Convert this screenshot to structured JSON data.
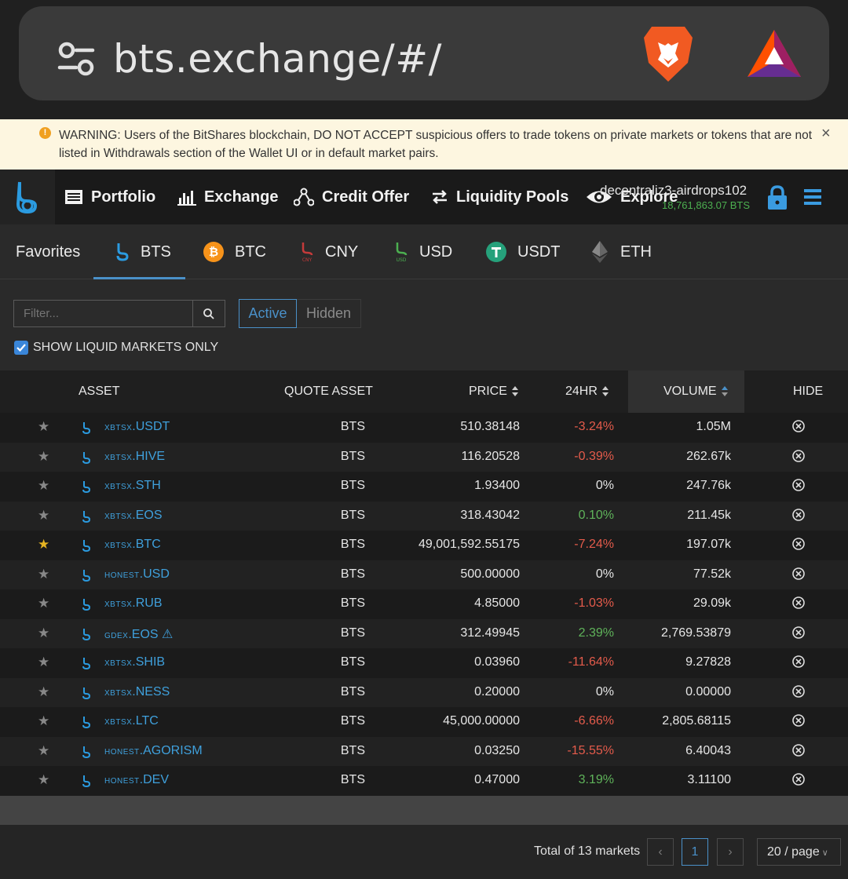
{
  "browser": {
    "url": "bts.exchange/#/",
    "icons": [
      "tune-icon",
      "brave-lion-icon",
      "bat-triangle-icon"
    ]
  },
  "warning": {
    "text": "WARNING: Users of the BitShares blockchain, DO NOT ACCEPT suspicious offers to trade tokens on private markets or tokens that are not listed in Withdrawals section of the Wallet UI or in default market pairs.",
    "close": "×"
  },
  "nav": {
    "items": [
      "Portfolio",
      "Exchange",
      "Credit Offer",
      "Liquidity Pools",
      "Explore"
    ],
    "account_name": "decentraliz3-airdrops102",
    "account_balance": "18,761,863.07 BTS"
  },
  "tabs": {
    "favorites": "Favorites",
    "items": [
      "BTS",
      "BTC",
      "CNY",
      "USD",
      "USDT",
      "ETH"
    ],
    "active": "BTS"
  },
  "filter": {
    "placeholder": "Filter...",
    "active_label": "Active",
    "hidden_label": "Hidden",
    "liquid_only_label": "SHOW LIQUID MARKETS ONLY",
    "liquid_only_checked": true
  },
  "table": {
    "headers": {
      "asset": "ASSET",
      "quote": "QUOTE ASSET",
      "price": "PRICE",
      "change": "24HR",
      "volume": "VOLUME",
      "hide": "HIDE"
    },
    "rows": [
      {
        "prefix": "XBTSX",
        "symbol": ".USDT",
        "warn": "",
        "quote": "BTS",
        "price": "510.38148",
        "change": "-3.24%",
        "dir": "neg",
        "volume": "1.05M",
        "starred": false
      },
      {
        "prefix": "XBTSX",
        "symbol": ".HIVE",
        "warn": "",
        "quote": "BTS",
        "price": "116.20528",
        "change": "-0.39%",
        "dir": "neg",
        "volume": "262.67k",
        "starred": false
      },
      {
        "prefix": "XBTSX",
        "symbol": ".STH",
        "warn": "",
        "quote": "BTS",
        "price": "1.93400",
        "change": "0%",
        "dir": "zero",
        "volume": "247.76k",
        "starred": false
      },
      {
        "prefix": "XBTSX",
        "symbol": ".EOS",
        "warn": "",
        "quote": "BTS",
        "price": "318.43042",
        "change": "0.10%",
        "dir": "pos",
        "volume": "211.45k",
        "starred": false
      },
      {
        "prefix": "XBTSX",
        "symbol": ".BTC",
        "warn": "",
        "quote": "BTS",
        "price": "49,001,592.55175",
        "change": "-7.24%",
        "dir": "neg",
        "volume": "197.07k",
        "starred": true
      },
      {
        "prefix": "HONEST",
        "symbol": ".USD",
        "warn": "",
        "quote": "BTS",
        "price": "500.00000",
        "change": "0%",
        "dir": "zero",
        "volume": "77.52k",
        "starred": false
      },
      {
        "prefix": "XBTSX",
        "symbol": ".RUB",
        "warn": "",
        "quote": "BTS",
        "price": "4.85000",
        "change": "-1.03%",
        "dir": "neg",
        "volume": "29.09k",
        "starred": false
      },
      {
        "prefix": "GDEX",
        "symbol": ".EOS",
        "warn": "⚠",
        "quote": "BTS",
        "price": "312.49945",
        "change": "2.39%",
        "dir": "pos",
        "volume": "2,769.53879",
        "starred": false
      },
      {
        "prefix": "XBTSX",
        "symbol": ".SHIB",
        "warn": "",
        "quote": "BTS",
        "price": "0.03960",
        "change": "-11.64%",
        "dir": "neg",
        "volume": "9.27828",
        "starred": false
      },
      {
        "prefix": "XBTSX",
        "symbol": ".NESS",
        "warn": "",
        "quote": "BTS",
        "price": "0.20000",
        "change": "0%",
        "dir": "zero",
        "volume": "0.00000",
        "starred": false
      },
      {
        "prefix": "XBTSX",
        "symbol": ".LTC",
        "warn": "",
        "quote": "BTS",
        "price": "45,000.00000",
        "change": "-6.66%",
        "dir": "neg",
        "volume": "2,805.68115",
        "starred": false
      },
      {
        "prefix": "HONEST",
        "symbol": ".AGORISM",
        "warn": "",
        "quote": "BTS",
        "price": "0.03250",
        "change": "-15.55%",
        "dir": "neg",
        "volume": "6.40043",
        "starred": false
      },
      {
        "prefix": "HONEST",
        "symbol": ".DEV",
        "warn": "",
        "quote": "BTS",
        "price": "0.47000",
        "change": "3.19%",
        "dir": "pos",
        "volume": "3.11100",
        "starred": false
      }
    ]
  },
  "pagination": {
    "total": "Total of 13 markets",
    "current_page": "1",
    "per_page": "20 / page"
  },
  "colors": {
    "accent": "#4a90c8",
    "negative": "#e45b4b",
    "positive": "#5fb35a",
    "star": "#e6b422",
    "balance": "#4caf50"
  }
}
